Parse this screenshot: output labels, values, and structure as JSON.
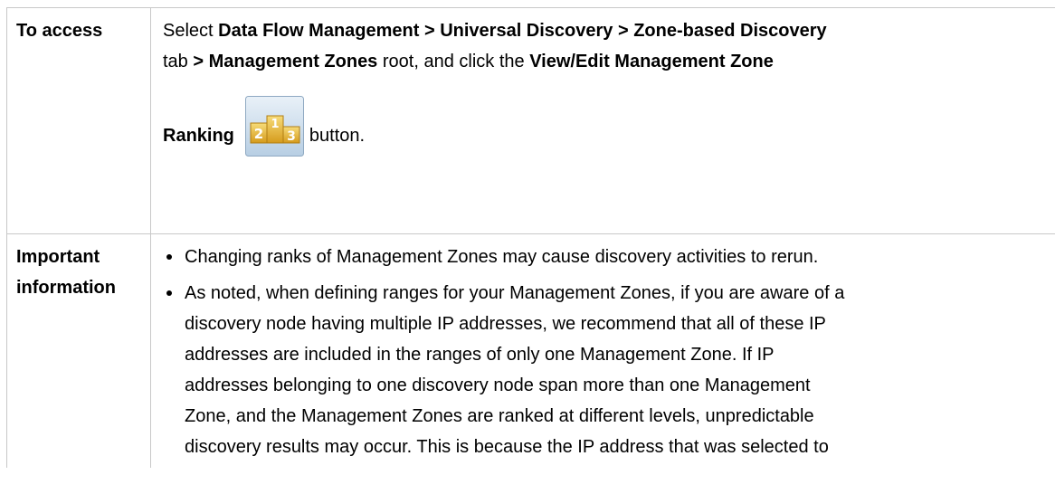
{
  "access": {
    "header": "To access",
    "line1": {
      "pre": "Select ",
      "path": "Data Flow Management > Universal Discovery > Zone-based Discovery"
    },
    "line2": {
      "tab": "tab",
      "sep": " > ",
      "node": "Management Zones",
      "mid1": " root, and click the ",
      "button_name": "View/Edit Management Zone"
    },
    "line3": {
      "button_name_end": "Ranking",
      "after": "button."
    },
    "icon": "ranking-podium-icon"
  },
  "info": {
    "header_line1": "Important",
    "header_line2": "information",
    "bullets": [
      [
        "Changing ranks of Management Zones may cause discovery activities to rerun."
      ],
      [
        "As noted, when defining ranges for your Management Zones, if you are aware of a",
        "discovery node having multiple IP addresses, we recommend that all of these IP",
        "addresses are included in the ranges of only one Management Zone. If IP",
        "addresses belonging to one discovery node span more than one Management",
        "Zone, and the Management Zones are ranked at different levels, unpredictable",
        "discovery results may occur. This is because the IP address that was selected to"
      ]
    ]
  }
}
